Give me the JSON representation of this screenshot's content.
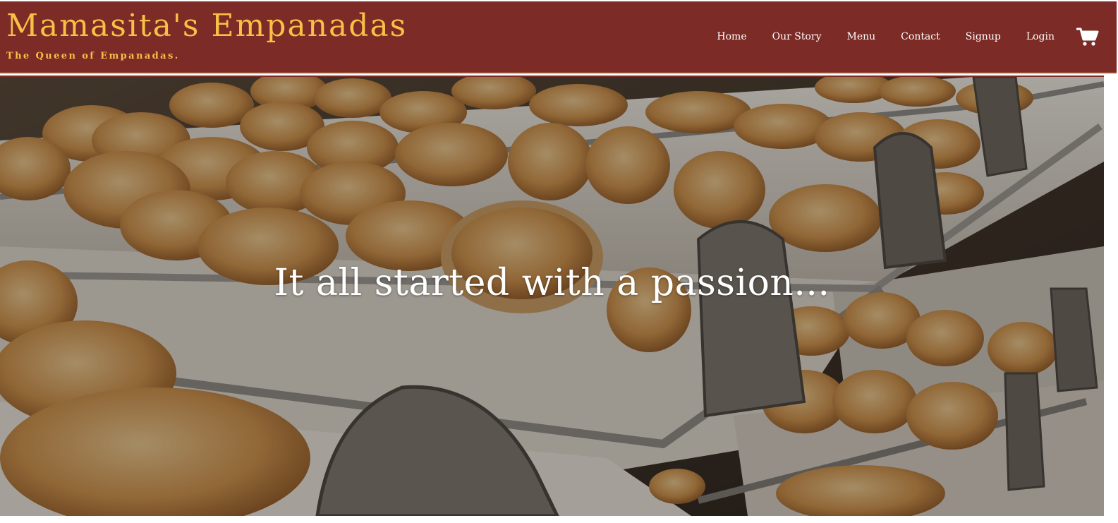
{
  "header": {
    "title": "Mamasita's Empanadas",
    "tagline": "The Queen of Empanadas.",
    "background_color": "#7c2b26",
    "title_color": "#f7c046"
  },
  "nav": {
    "items": [
      {
        "label": "Home"
      },
      {
        "label": "Our Story"
      },
      {
        "label": "Menu"
      },
      {
        "label": "Contact"
      },
      {
        "label": "Signup"
      },
      {
        "label": "Login"
      }
    ],
    "cart_icon": "shopping-cart-icon"
  },
  "hero": {
    "heading": "It all started with a passion...",
    "image_subject": "bakery-display-photo"
  }
}
